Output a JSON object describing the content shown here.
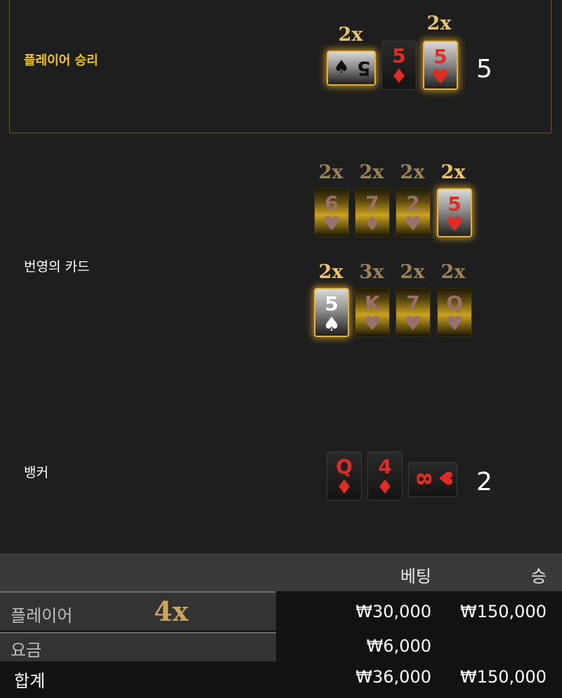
{
  "player": {
    "label": "플레이어 승리",
    "total": "5",
    "multipliers": [
      "2x",
      "2x"
    ],
    "cards": [
      {
        "rank": "5",
        "suit": "♠"
      },
      {
        "rank": "5",
        "suit": "♦"
      },
      {
        "rank": "5",
        "suit": "♥"
      }
    ]
  },
  "lucky": {
    "label": "번영의 카드",
    "row1": {
      "multipliers": [
        "2x",
        "2x",
        "2x",
        "2x"
      ],
      "cards": [
        {
          "rank": "6",
          "suit": "♥"
        },
        {
          "rank": "7",
          "suit": "♦"
        },
        {
          "rank": "2",
          "suit": "♥"
        },
        {
          "rank": "5",
          "suit": "♥"
        }
      ]
    },
    "row2": {
      "multipliers": [
        "2x",
        "3x",
        "2x",
        "2x"
      ],
      "cards": [
        {
          "rank": "5",
          "suit": "♠"
        },
        {
          "rank": "K",
          "suit": "♥"
        },
        {
          "rank": "7",
          "suit": "♥"
        },
        {
          "rank": "Q",
          "suit": "♥"
        }
      ]
    }
  },
  "banker": {
    "label": "뱅커",
    "total": "2",
    "cards": [
      {
        "rank": "Q",
        "suit": "♦"
      },
      {
        "rank": "4",
        "suit": "♦"
      },
      {
        "rank": "8",
        "suit": "♥"
      }
    ]
  },
  "table": {
    "header": {
      "bet": "베팅",
      "win": "승"
    },
    "rows": [
      {
        "label": "플레이어",
        "multiplier": "4x",
        "bet": "₩30,000",
        "win": "₩150,000"
      },
      {
        "label": "요금",
        "bet": "₩6,000",
        "win": ""
      },
      {
        "label": "합계",
        "bet": "₩36,000",
        "win": "₩150,000"
      }
    ]
  }
}
